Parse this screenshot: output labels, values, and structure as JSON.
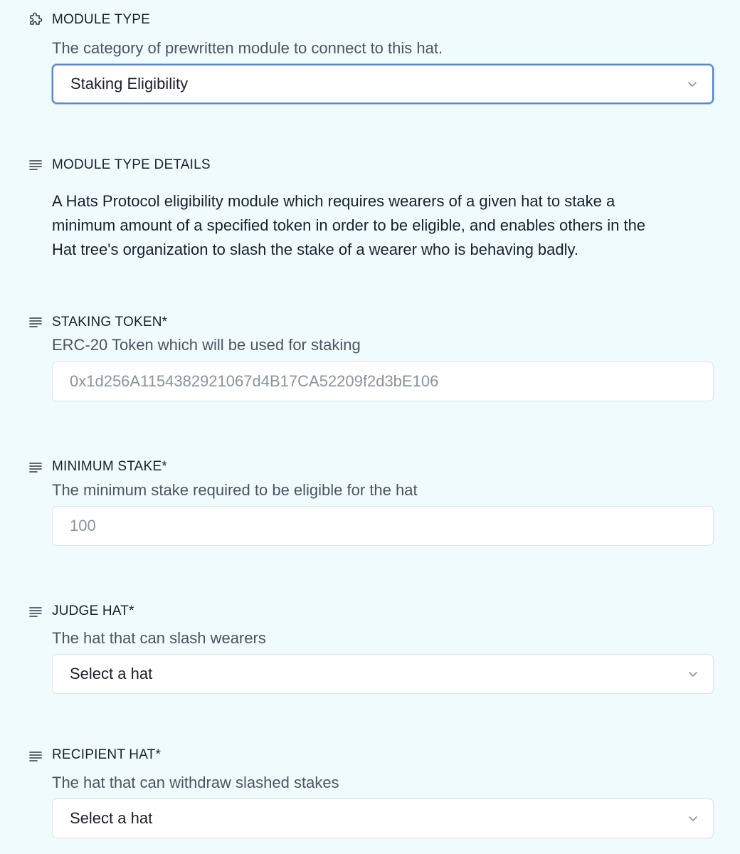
{
  "module_type": {
    "icon": "puzzle-icon",
    "label": "MODULE TYPE",
    "description": "The category of prewritten module to connect to this hat.",
    "selected": "Staking Eligibility"
  },
  "module_type_details": {
    "icon": "text-lines-icon",
    "label": "MODULE TYPE DETAILS",
    "lines": [
      "A Hats Protocol eligibility module which requires wearers of a given hat to stake a",
      "minimum amount of a specified token in order to be eligible, and enables others in the",
      "Hat tree's organization to slash the stake of a wearer who is behaving badly."
    ]
  },
  "staking_token": {
    "icon": "text-lines-icon",
    "label": "STAKING TOKEN*",
    "description": "ERC-20 Token which will be used for staking",
    "placeholder": "0x1d256A1154382921067d4B17CA52209f2d3bE106"
  },
  "minimum_stake": {
    "icon": "text-lines-icon",
    "label": "MINIMUM STAKE*",
    "description": "The minimum stake required to be eligible for the hat",
    "placeholder": "100"
  },
  "judge_hat": {
    "icon": "text-lines-icon",
    "label": "JUDGE HAT*",
    "description": "The hat that can slash wearers",
    "selected": "Select a hat"
  },
  "recipient_hat": {
    "icon": "text-lines-icon",
    "label": "RECIPIENT HAT*",
    "description": "The hat that can withdraw slashed stakes",
    "selected": "Select a hat"
  },
  "colors": {
    "background": "#f0fbfe",
    "focus_border": "#5b86d0",
    "field_border": "#dfe3e8",
    "muted_text": "#4a5560",
    "placeholder_text": "#8a939c"
  }
}
